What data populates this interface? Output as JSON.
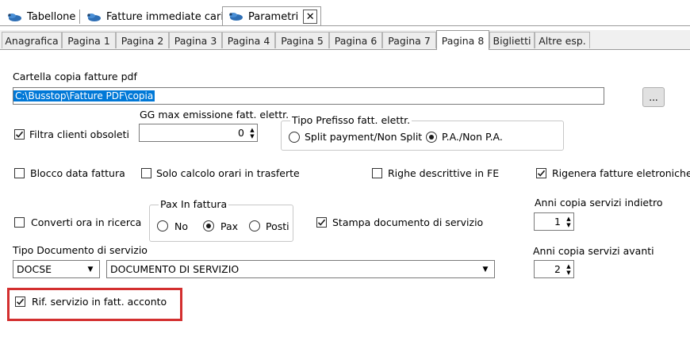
{
  "doc_tabs": [
    {
      "label": "Tabellone",
      "icon": "app-icon"
    },
    {
      "label": "Fatture immediate carica",
      "icon": "app-icon"
    },
    {
      "label": "Parametri",
      "icon": "app-icon",
      "active": true
    }
  ],
  "close_glyph": "✕",
  "page_tabs": [
    "Anagrafica",
    "Pagina 1",
    "Pagina 2",
    "Pagina 3",
    "Pagina 4",
    "Pagina 5",
    "Pagina 6",
    "Pagina 7",
    "Pagina 8",
    "Biglietti",
    "Altre esp."
  ],
  "active_page_tab": "Pagina 8",
  "form": {
    "pdf_folder_label": "Cartella copia fatture pdf",
    "pdf_folder_value": "C:\\Busstop\\Fatture PDF\\copia",
    "browse_label": "...",
    "filter_obsolete_label": "Filtra clienti obsoleti",
    "filter_obsolete_checked": true,
    "gg_max_label": "GG max emissione fatt. elettr.",
    "gg_max_value": "0",
    "prefix_group_label": "Tipo Prefisso fatt. elettr.",
    "prefix_split_label": "Split payment/Non Split",
    "prefix_pa_label": "P.A./Non P.A.",
    "prefix_selected": "P.A./Non P.A.",
    "blocco_label": "Blocco data fattura",
    "solo_calcolo_label": "Solo calcolo orari in trasferte",
    "righe_label": "Righe descrittive in FE",
    "rigenera_label": "Rigenera fatture eletroniche",
    "rigenera_checked": true,
    "converti_label": "Converti ora in ricerca",
    "pax_group_label": "Pax In fattura",
    "pax_no_label": "No",
    "pax_pax_label": "Pax",
    "pax_posti_label": "Posti",
    "pax_selected": "Pax",
    "stampa_label": "Stampa documento di servizio",
    "stampa_checked": true,
    "anni_indietro_label": "Anni copia servizi indietro",
    "anni_indietro_value": "1",
    "tipo_doc_label": "Tipo Documento di servizio",
    "tipo_doc_code": "DOCSE",
    "tipo_doc_desc": "DOCUMENTO DI SERVIZIO",
    "anni_avanti_label": "Anni copia servizi avanti",
    "anni_avanti_value": "2",
    "rif_servizio_label": "Rif. servizio in fatt. acconto",
    "rif_servizio_checked": true
  },
  "colors": {
    "selection": "#0078d7",
    "highlight": "#d32f2f",
    "tab_icon": "#2f6fb5"
  }
}
